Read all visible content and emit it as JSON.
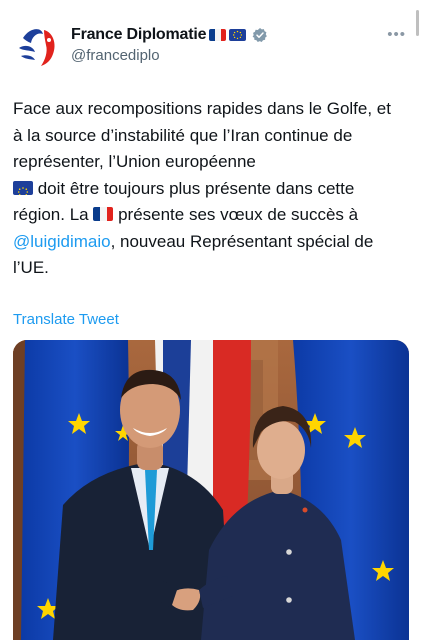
{
  "account": {
    "display_name": "France Diplomatie",
    "handle": "@francediplo",
    "badge_flags": [
      "france-flag",
      "eu-flag"
    ],
    "verified": true
  },
  "tweet": {
    "text_1": "Face aux recompositions rapides dans le Golfe, et à la source d’instabilité que l’Iran continue de représenter, l’Union européenne",
    "text_2": " doit être toujours plus présente dans cette région. La",
    "text_3": " présente ses vœux de succès à ",
    "mention": "@luigidimaio",
    "text_4": ", nouveau Représentant spécial de l’UE."
  },
  "translate_label": "Translate Tweet",
  "more_label": "•••",
  "colors": {
    "link_blue": "#1d9bf0",
    "text": "#0f1419",
    "muted": "#536471",
    "eu_blue": "#1d3f9a",
    "fr_blue": "#0a3c8c",
    "fr_red": "#e1231d"
  }
}
